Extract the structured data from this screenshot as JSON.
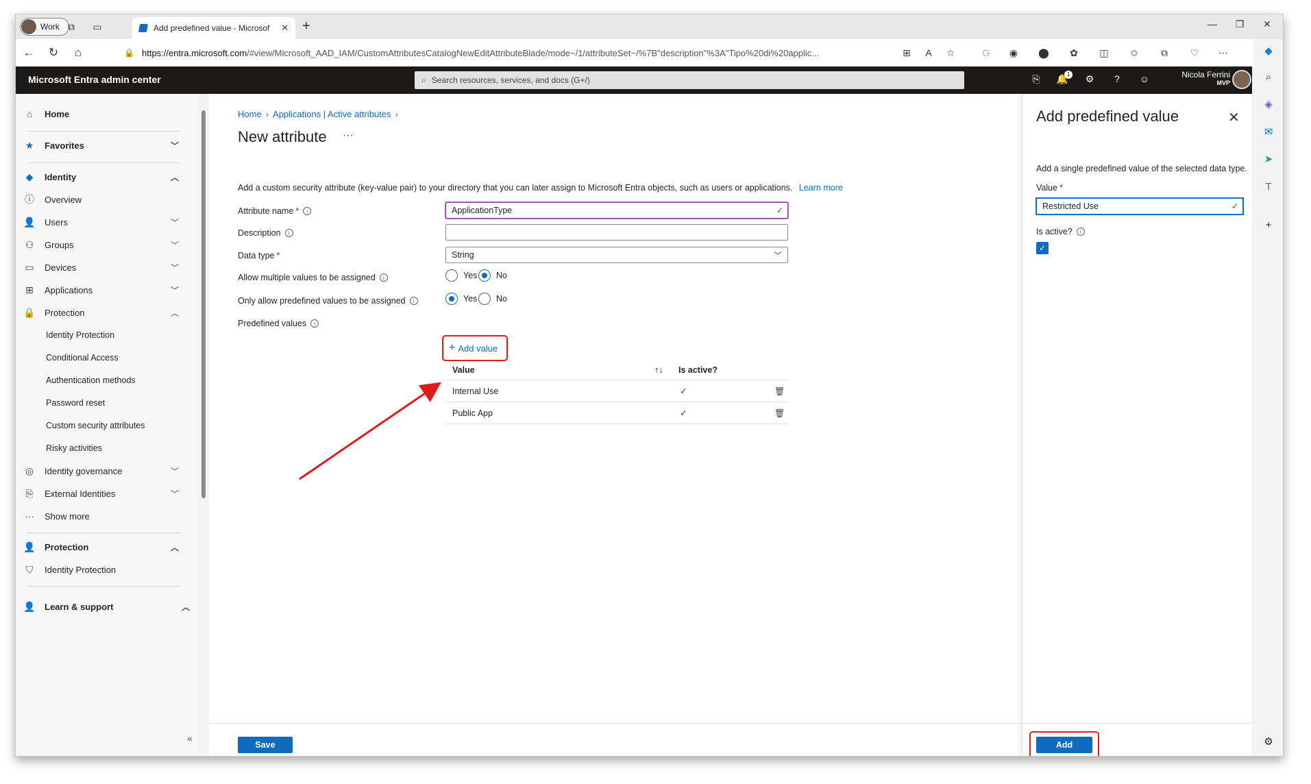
{
  "browser": {
    "profile_label": "Work",
    "tab_title": "Add predefined value - Microsof",
    "url_host": "https://entra.microsoft.com",
    "url_path": "/#view/Microsoft_AAD_IAM/CustomAttributesCatalogNewEditAttributeBlade/mode~/1/attributeSet~/%7B\"description\"%3A\"Tipo%20di%20applic..."
  },
  "portal": {
    "brand": "Microsoft Entra admin center",
    "search_placeholder": "Search resources, services, and docs (G+/)",
    "notification_count": "1",
    "user_name": "Nicola Ferrini",
    "user_badge": "MVP"
  },
  "nav": {
    "home": "Home",
    "favorites": "Favorites",
    "identity": "Identity",
    "overview": "Overview",
    "users": "Users",
    "groups": "Groups",
    "devices": "Devices",
    "applications": "Applications",
    "protection": "Protection",
    "identity_protection": "Identity Protection",
    "conditional_access": "Conditional Access",
    "authentication_methods": "Authentication methods",
    "password_reset": "Password reset",
    "custom_security_attributes": "Custom security attributes",
    "risky_activities": "Risky activities",
    "identity_governance": "Identity governance",
    "external_identities": "External Identities",
    "show_more": "Show more",
    "protection2": "Protection",
    "identity_protection2": "Identity Protection",
    "learn_support": "Learn & support"
  },
  "main": {
    "breadcrumb": [
      "Home",
      "Applications | Active attributes"
    ],
    "title": "New attribute",
    "more": "···",
    "intro": "Add a custom security attribute (key-value pair) to your directory that you can later assign to Microsoft Entra objects, such as users or applications.",
    "learn_more": "Learn more",
    "labels": {
      "attribute_name": "Attribute name",
      "description": "Description",
      "data_type": "Data type",
      "allow_multiple": "Allow multiple values to be assigned",
      "only_predefined": "Only allow predefined values to be assigned",
      "predefined_values": "Predefined values"
    },
    "attribute_name_value": "ApplicationType",
    "description_value": "",
    "data_type_value": "String",
    "yes": "Yes",
    "no": "No",
    "add_value": "Add value",
    "table": {
      "col_value": "Value",
      "col_active": "Is active?",
      "rows": [
        {
          "value": "Internal Use"
        },
        {
          "value": "Public App"
        }
      ]
    },
    "save": "Save"
  },
  "blade": {
    "title": "Add predefined value",
    "description": "Add a single predefined value of the selected data type.",
    "value_label": "Value",
    "value": "Restricted Use",
    "is_active_label": "Is active?",
    "add": "Add"
  },
  "colors": {
    "accent": "#0f6cbd",
    "header_bg": "#1b1a19",
    "highlight": "#e01b1b"
  }
}
